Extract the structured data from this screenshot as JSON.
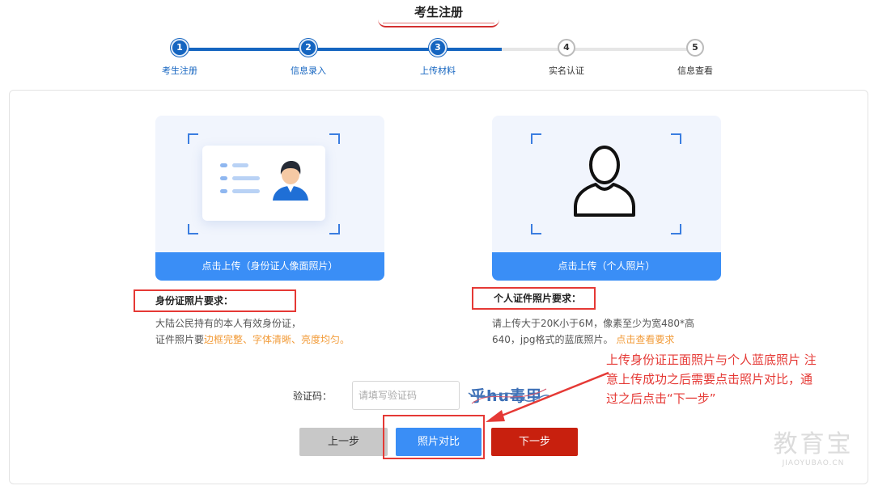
{
  "header": {
    "title": "考生注册"
  },
  "steps": [
    {
      "number": "1",
      "label": "考生注册",
      "status": "done"
    },
    {
      "number": "2",
      "label": "信息录入",
      "status": "done"
    },
    {
      "number": "3",
      "label": "上传材料",
      "status": "current"
    },
    {
      "number": "4",
      "label": "实名认证",
      "status": "todo"
    },
    {
      "number": "5",
      "label": "信息查看",
      "status": "todo"
    }
  ],
  "upload_id": {
    "button_label": "点击上传（身份证人像面照片）",
    "requirement_title": "身份证照片要求：",
    "requirement_line1": "大陆公民持有的本人有效身份证，",
    "requirement_line2_prefix": "证件照片要",
    "requirement_line2_highlight": "边框完整、字体清晰、亮度均匀。"
  },
  "upload_personal": {
    "button_label": "点击上传（个人照片）",
    "requirement_title": "个人证件照片要求：",
    "requirement_line1": "请上传大于20K小于6M，像素至少为宽480*高",
    "requirement_line2_prefix": "640，jpg格式的蓝底照片。",
    "requirement_link": "点击查看要求"
  },
  "captcha": {
    "label": "验证码：",
    "placeholder": "请填写验证码",
    "image_text": "乎hu毒甲"
  },
  "buttons": {
    "prev": "上一步",
    "compare": "照片对比",
    "next": "下一步"
  },
  "annotation": {
    "line1": "上传身份证正面照片与个人蓝底照片 注",
    "line2": "意上传成功之后需要点击照片对比，通",
    "line3": "过之后点击“下一步”"
  },
  "watermark": {
    "main": "教育宝",
    "sub": "JIAOYUBAO.CN"
  },
  "colors": {
    "primary_blue": "#3a8ef6",
    "step_blue": "#1565c0",
    "next_red": "#c8200e",
    "annotation_red": "#e53935",
    "highlight_orange": "#f29b38"
  }
}
